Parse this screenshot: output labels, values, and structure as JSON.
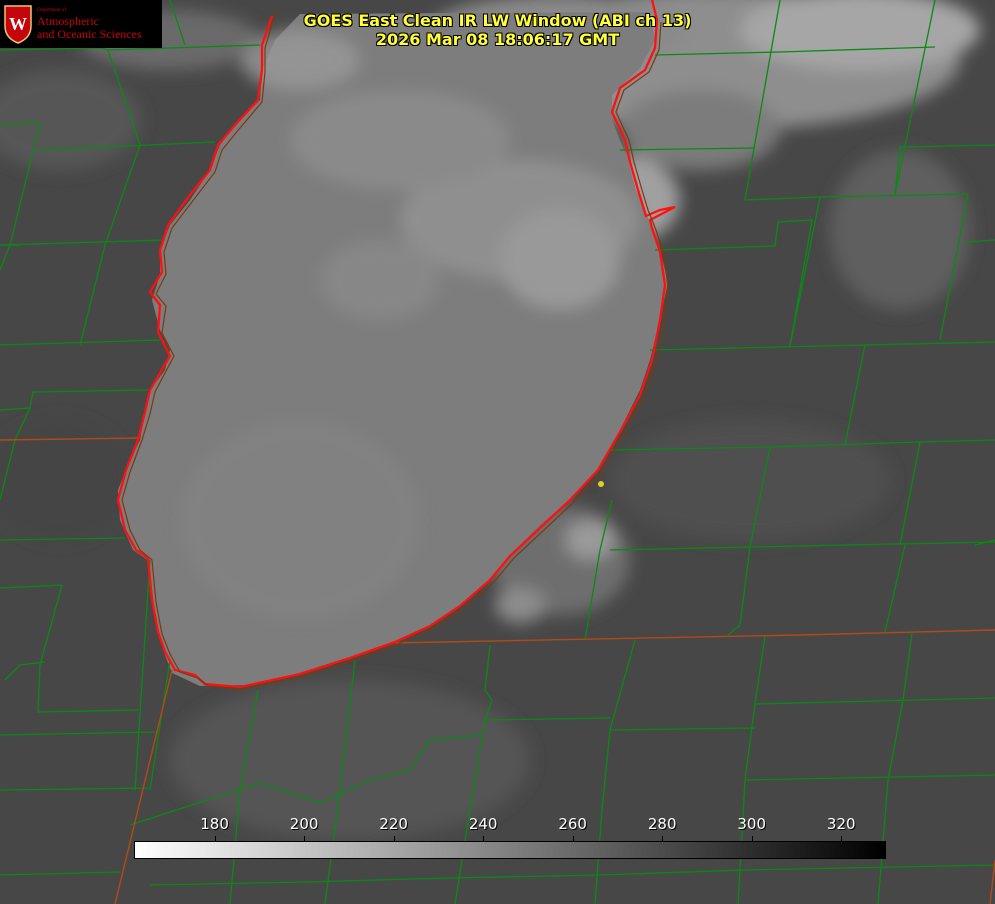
{
  "header": {
    "title_line1": "GOES East Clean IR LW Window (ABI ch 13)",
    "title_line2": "2026 Mar 08 18:06:17 GMT"
  },
  "logo": {
    "department": "Department of",
    "line1": "Atmospheric",
    "line2": "and Oceanic Sciences",
    "crest_letter": "W"
  },
  "colorbar": {
    "ticks": [
      "180",
      "200",
      "220",
      "240",
      "260",
      "280",
      "300",
      "320"
    ],
    "range": [
      162,
      330
    ],
    "gradient": "white-to-black",
    "start_color": "#ffffff",
    "end_color": "#000000"
  },
  "colors": {
    "lake_fill": "#7b7b7b",
    "land": "#4a4a4a",
    "county_lines": "#0a8a14",
    "state_lines": "#b34a14",
    "coastline": "#ff1010",
    "title_text": "#ffff3c",
    "marker": "#e0d020"
  }
}
